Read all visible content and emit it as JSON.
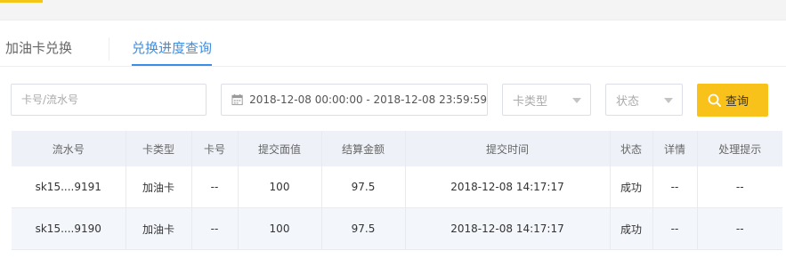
{
  "tabs": [
    {
      "label": "加油卡兑换"
    },
    {
      "label": "兑换进度查询"
    }
  ],
  "filters": {
    "search_placeholder": "卡号/流水号",
    "date_range": "2018-12-08 00:00:00 - 2018-12-08 23:59:59",
    "card_type_label": "卡类型",
    "status_label": "状态",
    "query_label": "查询"
  },
  "table": {
    "headers": [
      "流水号",
      "卡类型",
      "卡号",
      "提交面值",
      "结算金额",
      "提交时间",
      "状态",
      "详情",
      "处理提示"
    ],
    "rows": [
      [
        "sk15....9191",
        "加油卡",
        "--",
        "100",
        "97.5",
        "2018-12-08 14:17:17",
        "成功",
        "--",
        "--"
      ],
      [
        "sk15....9190",
        "加油卡",
        "--",
        "100",
        "97.5",
        "2018-12-08 14:17:17",
        "成功",
        "--",
        "--"
      ]
    ]
  },
  "colors": {
    "accent_yellow": "#f8c21b",
    "active_tab_blue": "#3a8ee6",
    "header_bg": "#eef2f8"
  },
  "icons": {
    "calendar": "calendar-icon",
    "search": "search-icon",
    "dropdown": "chevron-down-icon"
  }
}
